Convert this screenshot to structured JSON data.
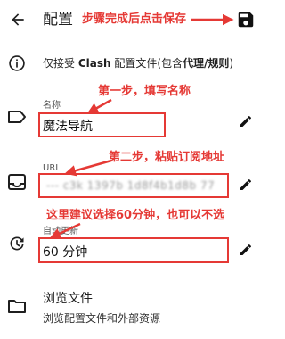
{
  "header": {
    "title": "配置",
    "back_icon": "arrow-left-icon",
    "save_icon": "floppy-disk-save-icon"
  },
  "annotations": {
    "save_hint": "步骤完成后点击保存",
    "step1": "第一步，填写名称",
    "step2": "第二步，粘贴订阅地址",
    "step3": "这里建议选择60分钟，也可以不选",
    "color": "#e53935"
  },
  "info": {
    "icon": "info-icon",
    "prefix": "仅接受 ",
    "clash": "Clash",
    "middle": " 配置文件(包含",
    "bold_part": "代理/规则",
    "suffix": ")"
  },
  "name_field": {
    "icon": "label-tag-icon",
    "label": "名称",
    "value": "魔法导航",
    "edit_icon": "pencil-edit-icon"
  },
  "url_field": {
    "icon": "inbox-tray-icon",
    "label": "URL",
    "value": "--- c3k 1397b 1d8f4b1d8b 77",
    "edit_icon": "pencil-edit-icon"
  },
  "auto_update_field": {
    "icon": "timer-refresh-icon",
    "label": "自动更新",
    "value": "60 分钟",
    "edit_icon": "pencil-edit-icon"
  },
  "browse": {
    "icon": "folder-icon",
    "title": "浏览文件",
    "subtitle": "浏览配置文件和外部资源"
  }
}
